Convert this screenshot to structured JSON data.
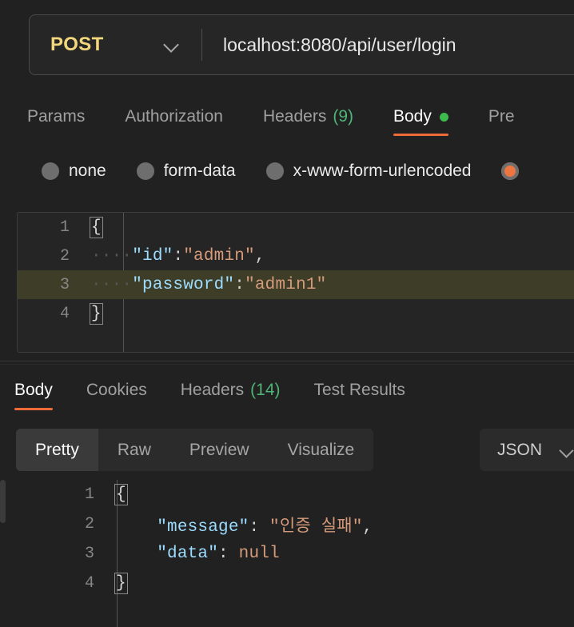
{
  "request": {
    "method": "POST",
    "method_chevron_icon": "chevron-down-icon",
    "url": "localhost:8080/api/user/login",
    "tabs": [
      {
        "label": "Params",
        "count": "",
        "active": false,
        "dot": false
      },
      {
        "label": "Authorization",
        "count": "",
        "active": false,
        "dot": false
      },
      {
        "label": "Headers",
        "count": "(9)",
        "active": false,
        "dot": false
      },
      {
        "label": "Body",
        "count": "",
        "active": true,
        "dot": true
      },
      {
        "label": "Pre",
        "count": "",
        "active": false,
        "dot": false
      }
    ],
    "body_types": [
      {
        "label": "none",
        "selected": false
      },
      {
        "label": "form-data",
        "selected": false
      },
      {
        "label": "x-www-form-urlencoded",
        "selected": false
      },
      {
        "label": "",
        "selected": true
      }
    ],
    "body_code": [
      {
        "number": "1",
        "highlight": false,
        "tokens": [
          {
            "t": "{",
            "c": "brace"
          }
        ]
      },
      {
        "number": "2",
        "highlight": false,
        "tokens": [
          {
            "t": "····",
            "c": "ws"
          },
          {
            "t": "\"id\"",
            "c": "k"
          },
          {
            "t": ":",
            "c": "p"
          },
          {
            "t": "\"admin\"",
            "c": "s"
          },
          {
            "t": ",",
            "c": "p"
          }
        ]
      },
      {
        "number": "3",
        "highlight": true,
        "tokens": [
          {
            "t": "····",
            "c": "ws"
          },
          {
            "t": "\"password\"",
            "c": "k"
          },
          {
            "t": ":",
            "c": "p"
          },
          {
            "t": "\"admin1\"",
            "c": "s"
          }
        ]
      },
      {
        "number": "4",
        "highlight": false,
        "tokens": [
          {
            "t": "}",
            "c": "brace"
          }
        ]
      }
    ]
  },
  "response": {
    "tabs": [
      {
        "label": "Body",
        "count": "",
        "active": true
      },
      {
        "label": "Cookies",
        "count": "",
        "active": false
      },
      {
        "label": "Headers",
        "count": "(14)",
        "active": false
      },
      {
        "label": "Test Results",
        "count": "",
        "active": false
      }
    ],
    "view_modes": [
      {
        "label": "Pretty",
        "active": true
      },
      {
        "label": "Raw",
        "active": false
      },
      {
        "label": "Preview",
        "active": false
      },
      {
        "label": "Visualize",
        "active": false
      }
    ],
    "format": "JSON",
    "format_chevron_icon": "chevron-down-icon",
    "body_code": [
      {
        "number": "1",
        "highlight": false,
        "tokens": [
          {
            "t": "{",
            "c": "brace"
          }
        ]
      },
      {
        "number": "2",
        "highlight": false,
        "tokens": [
          {
            "t": "    ",
            "c": "ws"
          },
          {
            "t": "\"message\"",
            "c": "k"
          },
          {
            "t": ": ",
            "c": "p"
          },
          {
            "t": "\"인증 실패\"",
            "c": "s"
          },
          {
            "t": ",",
            "c": "p"
          }
        ]
      },
      {
        "number": "3",
        "highlight": false,
        "tokens": [
          {
            "t": "    ",
            "c": "ws"
          },
          {
            "t": "\"data\"",
            "c": "k"
          },
          {
            "t": ": ",
            "c": "p"
          },
          {
            "t": "null",
            "c": "n"
          }
        ]
      },
      {
        "number": "4",
        "highlight": false,
        "tokens": [
          {
            "t": "}",
            "c": "brace"
          }
        ]
      }
    ]
  },
  "colors": {
    "accent_orange": "#ef6b39",
    "method_yellow": "#f3d77d",
    "dot_green": "#3dba4e",
    "count_green": "#4fb477",
    "json_key": "#9cdcfe",
    "json_string": "#d49a7a",
    "highlight_line": "#3e3e28",
    "background": "#212121"
  }
}
